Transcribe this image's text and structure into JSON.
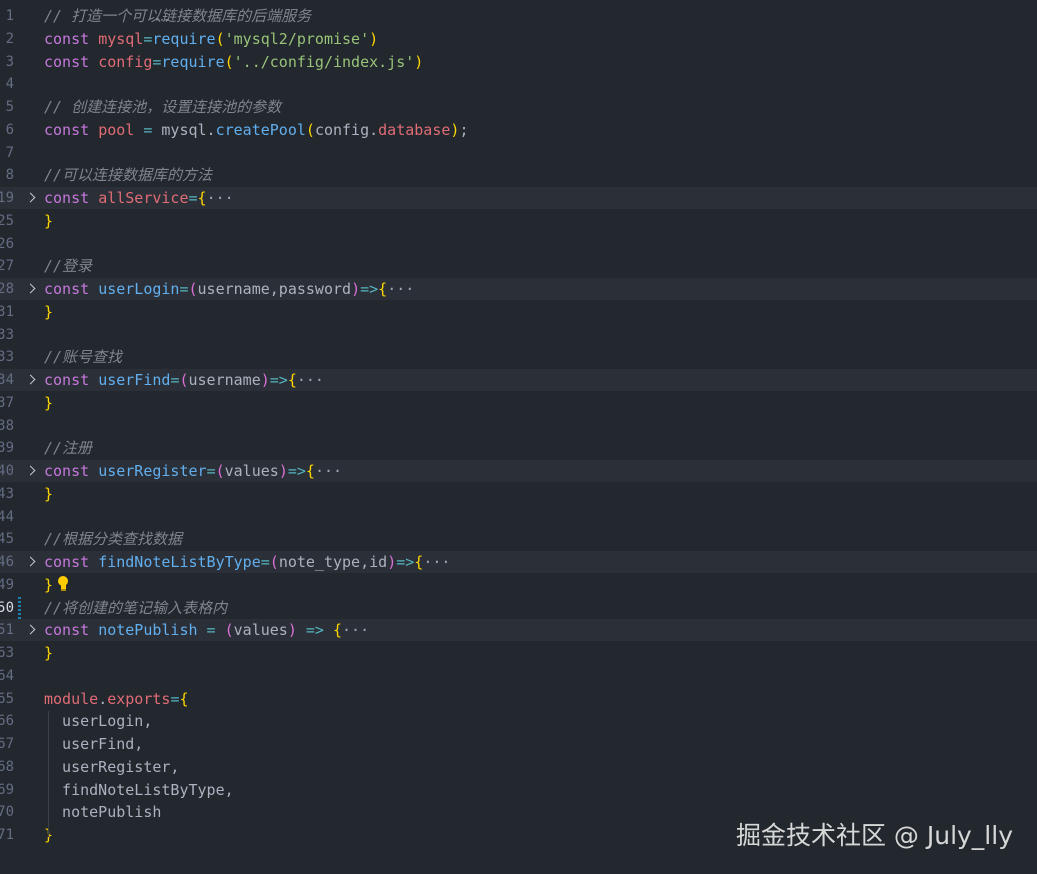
{
  "editor": {
    "lines": [
      {
        "num": "1",
        "code": [
          [
            "comment",
            "// 打造一个可以链接数据库的后端服务"
          ]
        ]
      },
      {
        "num": "2",
        "code": [
          [
            "kw",
            "const "
          ],
          [
            "var",
            "mysql"
          ],
          [
            "op",
            "="
          ],
          [
            "fn",
            "require"
          ],
          [
            "br",
            "("
          ],
          [
            "str",
            "'mysql2/promise'"
          ],
          [
            "br",
            ")"
          ]
        ]
      },
      {
        "num": "3",
        "code": [
          [
            "kw",
            "const "
          ],
          [
            "var",
            "config"
          ],
          [
            "op",
            "="
          ],
          [
            "fn",
            "require"
          ],
          [
            "br",
            "("
          ],
          [
            "str",
            "'../config/index.js'"
          ],
          [
            "br",
            ")"
          ]
        ]
      },
      {
        "num": "4",
        "code": []
      },
      {
        "num": "5",
        "code": [
          [
            "comment",
            "// 创建连接池，设置连接池的参数"
          ]
        ]
      },
      {
        "num": "6",
        "code": [
          [
            "kw",
            "const "
          ],
          [
            "var",
            "pool"
          ],
          [
            "op",
            " = "
          ],
          [
            "plain",
            "mysql."
          ],
          [
            "fn",
            "createPool"
          ],
          [
            "br",
            "("
          ],
          [
            "plain",
            "config."
          ],
          [
            "var",
            "database"
          ],
          [
            "br",
            ")"
          ],
          [
            "plain",
            ";"
          ]
        ]
      },
      {
        "num": "7",
        "code": []
      },
      {
        "num": "8",
        "code": [
          [
            "comment",
            "//可以连接数据库的方法"
          ]
        ]
      },
      {
        "num": "19",
        "folded": true,
        "code": [
          [
            "kw",
            "const "
          ],
          [
            "var",
            "allService"
          ],
          [
            "op",
            "="
          ],
          [
            "br",
            "{"
          ],
          [
            "ellipsis",
            "···"
          ]
        ]
      },
      {
        "num": "25",
        "code": [
          [
            "br",
            "}"
          ]
        ]
      },
      {
        "num": "26",
        "code": []
      },
      {
        "num": "27",
        "code": [
          [
            "comment",
            "//登录"
          ]
        ]
      },
      {
        "num": "28",
        "folded": true,
        "code": [
          [
            "kw",
            "const "
          ],
          [
            "fn",
            "userLogin"
          ],
          [
            "op",
            "="
          ],
          [
            "br2",
            "("
          ],
          [
            "plain",
            "username,password"
          ],
          [
            "br2",
            ")"
          ],
          [
            "op",
            "=>"
          ],
          [
            "br",
            "{"
          ],
          [
            "ellipsis",
            "···"
          ]
        ]
      },
      {
        "num": "31",
        "code": [
          [
            "br",
            "}"
          ]
        ]
      },
      {
        "num": "33",
        "code": []
      },
      {
        "num": "33",
        "code": [
          [
            "comment",
            "//账号查找"
          ]
        ]
      },
      {
        "num": "34",
        "folded": true,
        "code": [
          [
            "kw",
            "const "
          ],
          [
            "fn",
            "userFind"
          ],
          [
            "op",
            "="
          ],
          [
            "br2",
            "("
          ],
          [
            "plain",
            "username"
          ],
          [
            "br2",
            ")"
          ],
          [
            "op",
            "=>"
          ],
          [
            "br",
            "{"
          ],
          [
            "ellipsis",
            "···"
          ]
        ]
      },
      {
        "num": "37",
        "code": [
          [
            "br",
            "}"
          ]
        ]
      },
      {
        "num": "38",
        "code": []
      },
      {
        "num": "39",
        "code": [
          [
            "comment",
            "//注册"
          ]
        ]
      },
      {
        "num": "40",
        "folded": true,
        "code": [
          [
            "kw",
            "const "
          ],
          [
            "fn",
            "userRegister"
          ],
          [
            "op",
            "="
          ],
          [
            "br2",
            "("
          ],
          [
            "plain",
            "values"
          ],
          [
            "br2",
            ")"
          ],
          [
            "op",
            "=>"
          ],
          [
            "br",
            "{"
          ],
          [
            "ellipsis",
            "···"
          ]
        ]
      },
      {
        "num": "43",
        "code": [
          [
            "br",
            "}"
          ]
        ]
      },
      {
        "num": "44",
        "code": []
      },
      {
        "num": "45",
        "code": [
          [
            "comment",
            "//根据分类查找数据"
          ]
        ]
      },
      {
        "num": "46",
        "folded": true,
        "code": [
          [
            "kw",
            "const "
          ],
          [
            "fn",
            "findNoteListByType"
          ],
          [
            "op",
            "="
          ],
          [
            "br2",
            "("
          ],
          [
            "plain",
            "note_type,id"
          ],
          [
            "br2",
            ")"
          ],
          [
            "op",
            "=>"
          ],
          [
            "br",
            "{"
          ],
          [
            "ellipsis",
            "···"
          ]
        ]
      },
      {
        "num": "49",
        "bulb": true,
        "code": [
          [
            "br",
            "}"
          ]
        ]
      },
      {
        "num": "50",
        "active": true,
        "modified": true,
        "code": [
          [
            "comment",
            "//将创建的笔记输入表格内"
          ]
        ]
      },
      {
        "num": "51",
        "folded": true,
        "code": [
          [
            "kw",
            "const "
          ],
          [
            "fn",
            "notePublish"
          ],
          [
            "op",
            " = "
          ],
          [
            "br2",
            "("
          ],
          [
            "plain",
            "values"
          ],
          [
            "br2",
            ")"
          ],
          [
            "op",
            " => "
          ],
          [
            "br",
            "{"
          ],
          [
            "ellipsis",
            "···"
          ]
        ]
      },
      {
        "num": "63",
        "code": [
          [
            "br",
            "}"
          ]
        ]
      },
      {
        "num": "64",
        "code": []
      },
      {
        "num": "65",
        "code": [
          [
            "kw-mod",
            "module"
          ],
          [
            "plain",
            "."
          ],
          [
            "var",
            "exports"
          ],
          [
            "op",
            "="
          ],
          [
            "br",
            "{"
          ]
        ]
      },
      {
        "num": "66",
        "code": [
          [
            "plain",
            "  userLogin,"
          ]
        ]
      },
      {
        "num": "67",
        "code": [
          [
            "plain",
            "  userFind,"
          ]
        ]
      },
      {
        "num": "68",
        "code": [
          [
            "plain",
            "  userRegister,"
          ]
        ]
      },
      {
        "num": "69",
        "code": [
          [
            "plain",
            "  findNoteListByType,"
          ]
        ]
      },
      {
        "num": "70",
        "code": [
          [
            "plain",
            "  notePublish"
          ]
        ]
      },
      {
        "num": "71",
        "code": [
          [
            "br",
            "}"
          ]
        ]
      }
    ],
    "hover_dots": "···"
  },
  "watermark": "掘金技术社区 @ July_lly"
}
